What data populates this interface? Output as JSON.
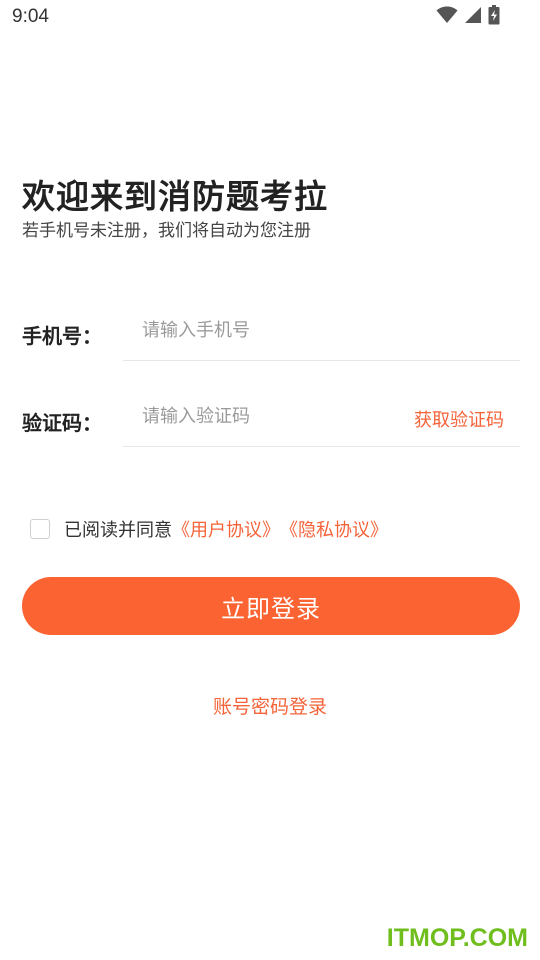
{
  "status_bar": {
    "time": "9:04",
    "icons": [
      "wifi-icon",
      "signal-icon",
      "battery-charging-icon"
    ]
  },
  "welcome": {
    "title": "欢迎来到消防题考拉",
    "subtitle": "若手机号未注册，我们将自动为您注册"
  },
  "form": {
    "phone_label": "手机号：",
    "phone_placeholder": "请输入手机号",
    "phone_value": "",
    "code_label": "验证码：",
    "code_placeholder": "请输入验证码",
    "code_value": "",
    "get_code_label": "获取验证码"
  },
  "agreement": {
    "checked": false,
    "text": "已阅读并同意",
    "user_agreement": "《用户协议》",
    "privacy_policy": "《隐私协议》"
  },
  "login_button_label": "立即登录",
  "alt_login_label": "账号密码登录",
  "watermark": "ITMOP.COM",
  "colors": {
    "accent": "#fb6432",
    "link": "#f4633a",
    "watermark": "#6fbe1e",
    "text": "#222222",
    "placeholder": "#9a9a9a"
  }
}
